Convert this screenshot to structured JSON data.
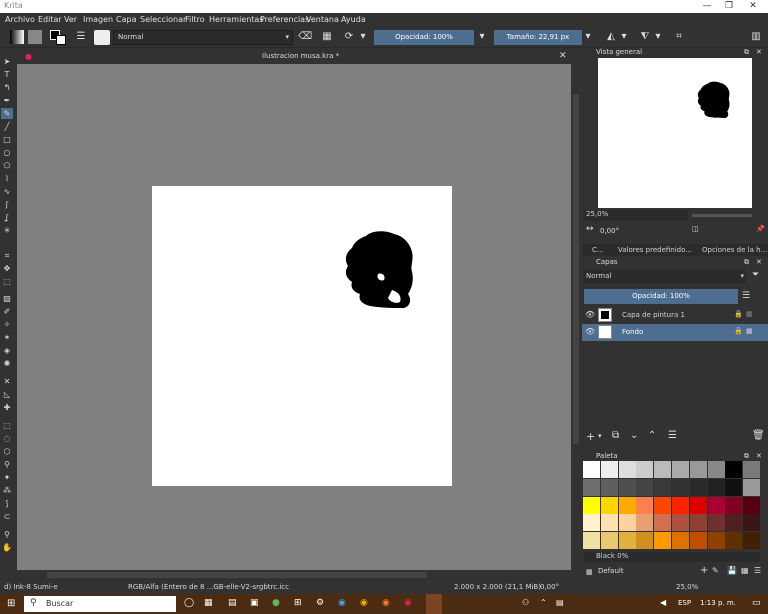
{
  "window": {
    "title": "Krita"
  },
  "menu": [
    "Archivo",
    "Editar",
    "Ver",
    "Imagen",
    "Capa",
    "Seleccionar",
    "Filtro",
    "Herramientas",
    "Preferencias",
    "Ventana",
    "Ayuda"
  ],
  "toolbar": {
    "blend_mode": "Normal",
    "opacity": "Opacidad: 100%",
    "size": "Tamaño: 22,91 px"
  },
  "document": {
    "tab_title": "Ilustracion musa.kra *"
  },
  "overview": {
    "title": "Vista general",
    "zoom": "25,0%",
    "rotation": "0,00°"
  },
  "dock_tabs": [
    "C...",
    "Valores predefinido...",
    "Opciones de la h..."
  ],
  "layers": {
    "title": "Capas",
    "blend_mode": "Normal",
    "opacity": "Opacidad:  100%",
    "items": [
      {
        "name": "Capa de pintura 1"
      },
      {
        "name": "Fondo"
      }
    ]
  },
  "palette": {
    "title": "Paleta",
    "selected_color": "Black 0%",
    "palette_name": "Default",
    "rows": [
      [
        "#ffffff",
        "#eeeeee",
        "#dddddd",
        "#cccccc",
        "#bbbbbb",
        "#aaaaaa",
        "#999999",
        "#888888",
        "#000000",
        "#7a7a7a"
      ],
      [
        "#6f6f6f",
        "#5f5f5f",
        "#4f4f4f",
        "#444444",
        "#3a3a3a",
        "#333333",
        "#2a2a2a",
        "#222222",
        "#111111",
        "#999999"
      ],
      [
        "#ffff00",
        "#ffd500",
        "#ffaa00",
        "#ff7f50",
        "#ff4500",
        "#ff2200",
        "#dd0000",
        "#aa0033",
        "#7f0022",
        "#550011"
      ],
      [
        "#fff2cc",
        "#ffe0b3",
        "#ffd0a0",
        "#e8a070",
        "#d07050",
        "#b05040",
        "#904030",
        "#703030",
        "#502020",
        "#3a1515"
      ],
      [
        "#f0e0a0",
        "#e8c870",
        "#e0b040",
        "#d09020",
        "#ff9900",
        "#e07000",
        "#c05000",
        "#904000",
        "#603000",
        "#402000"
      ]
    ]
  },
  "status": {
    "tool": "d) Ink-8 Sumi-e",
    "colorspace": "RGB/Alfa (Entero de 8 ...GB-elle-V2-srgbtrc.icc",
    "dimensions": "2.000 x 2.000 (21,1 MiB)",
    "rotation": "0,00°",
    "zoom": "25,0%"
  },
  "taskbar": {
    "search": "Buscar",
    "lang": "ESP",
    "time": "1:13 p. m."
  }
}
